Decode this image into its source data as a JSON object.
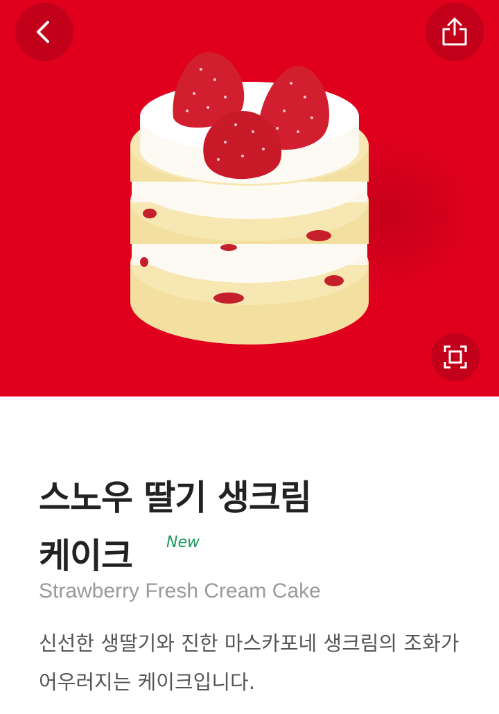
{
  "header": {
    "back_icon": "chevron-left-icon",
    "share_icon": "share-icon",
    "zoom_icon": "fullscreen-icon"
  },
  "hero": {
    "background_color": "#e0001e",
    "image_subject": "strawberry-cream-cake"
  },
  "product": {
    "title_line1": "스노우 딸기 생크림",
    "title_line2": "케이크",
    "badge": "New",
    "english_name": "Strawberry Fresh Cream Cake",
    "description": "신선한 생딸기와 진한 마스카포네 생크림의 조화가 어우러지는 케이크입니다."
  },
  "colors": {
    "accent": "#e0001e",
    "badge": "#1a9a5c",
    "title": "#222222",
    "subtitle": "#9a9a9a",
    "body": "#555555"
  }
}
